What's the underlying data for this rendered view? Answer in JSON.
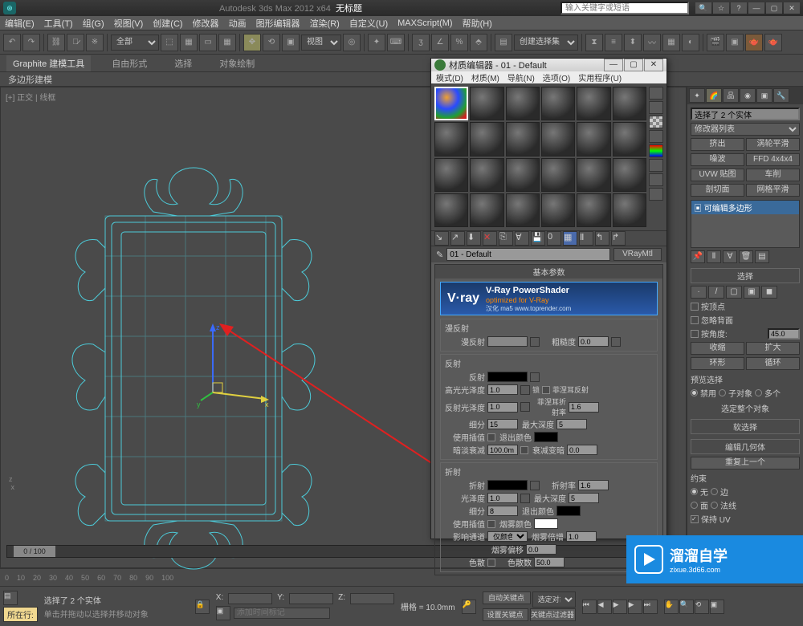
{
  "title_bar": {
    "app": "Autodesk 3ds Max 2012 x64",
    "doc": "无标题",
    "search_placeholder": "输入关键字或短语"
  },
  "menu": [
    "编辑(E)",
    "工具(T)",
    "组(G)",
    "视图(V)",
    "创建(C)",
    "修改器",
    "动画",
    "图形编辑器",
    "渲染(R)",
    "自定义(U)",
    "MAXScript(M)",
    "帮助(H)"
  ],
  "toolbar": {
    "select_filter": "全部",
    "view_dd": "视图",
    "create_sel": "创建选择集"
  },
  "ribbon": {
    "tabs": [
      "Graphite 建模工具",
      "自由形式",
      "选择",
      "对象绘制"
    ],
    "sub": "多边形建模"
  },
  "viewport": {
    "label": "[+] 正交 | 线框"
  },
  "mat_editor": {
    "title": "材质编辑器 - 01 - Default",
    "menu": [
      "模式(D)",
      "材质(M)",
      "导航(N)",
      "选项(O)",
      "实用程序(U)"
    ],
    "name": "01 - Default",
    "type": "VRayMtl",
    "rollout_basic": "基本参数",
    "vray": {
      "brand": "V·ray",
      "title": "V-Ray PowerShader",
      "sub": "optimized for V-Ray",
      "credit": "汉化 ma5 www.toprender.com"
    },
    "diffuse": {
      "title": "漫反射",
      "label": "漫反射",
      "rough_label": "粗糙度",
      "rough": "0.0"
    },
    "reflect": {
      "title": "反射",
      "label": "反射",
      "hg": "高光光泽度",
      "hg_v": "1.0",
      "lock": "锁",
      "fresnel": "菲涅耳反射",
      "rg": "反射光泽度",
      "rg_v": "1.0",
      "fior": "菲涅耳折射率",
      "fior_v": "1.6",
      "sub": "细分",
      "sub_v": "15",
      "maxd": "最大深度",
      "maxd_v": "5",
      "interp": "使用插值",
      "exitc": "退出颜色",
      "dim": "暗淡衰减",
      "dim_v": "100.0m",
      "dimd": "衰减变暗",
      "dimd_v": "0.0"
    },
    "refract": {
      "title": "折射",
      "label": "折射",
      "ior": "折射率",
      "ior_v": "1.6",
      "gloss": "光泽度",
      "gloss_v": "1.0",
      "maxd": "最大深度",
      "maxd_v": "5",
      "sub": "细分",
      "sub_v": "8",
      "exitc": "退出颜色",
      "interp": "使用插值",
      "fogc": "烟雾颜色",
      "shadow": "影响通道",
      "shadow_v": "仅颜色",
      "fogm": "烟雾倍增",
      "fogm_v": "1.0",
      "fogb": "烟雾偏移",
      "fogb_v": "0.0",
      "disp": "色散",
      "abbe": "色散数",
      "abbe_v": "50.0"
    }
  },
  "command_panel": {
    "sel_text": "选择了 2 个实体",
    "mod_list": "修改器列表",
    "btns": [
      [
        "挤出",
        "涡轮平滑"
      ],
      [
        "噪波",
        "FFD 4x4x4"
      ],
      [
        "UVW 贴图",
        "车削"
      ],
      [
        "剖切面",
        "网格平滑"
      ]
    ],
    "stack_item": "可编辑多边形",
    "rollouts": {
      "sel_hdr": "选择",
      "byvertex": "按顶点",
      "ignore": "忽略背面",
      "byangle": "按角度:",
      "angle": "45.0",
      "shrink": "收缩",
      "grow": "扩大",
      "ring": "环形",
      "loop": "循环",
      "preview": "预览选择",
      "p_off": "禁用",
      "p_sub": "子对象",
      "p_multi": "多个",
      "sel_whole": "选定整个对象",
      "soft_hdr": "软选择",
      "edit_hdr": "编辑几何体",
      "repeat": "重复上一个",
      "constraint": "约束",
      "c_none": "无",
      "c_edge": "边",
      "c_face": "面",
      "c_normal": "法线",
      "preserve_uv": "保持 UV"
    }
  },
  "timeline": {
    "pos": "0 / 100"
  },
  "status": {
    "sel": "选择了 2 个实体",
    "prompt": "单击并拖动以选择并移动对象",
    "x": "X:",
    "y": "Y:",
    "z": "Z:",
    "grid": "栅格 = 10.0mm",
    "autokey": "自动关键点",
    "setkey": "设置关键点",
    "selsel": "选定对象",
    "keyfilter": "关键点过滤器",
    "addtag": "添加时间标记",
    "allrow": "所在行:"
  },
  "watermark": {
    "brand": "溜溜自学",
    "url": "zixue.3d66.com"
  }
}
